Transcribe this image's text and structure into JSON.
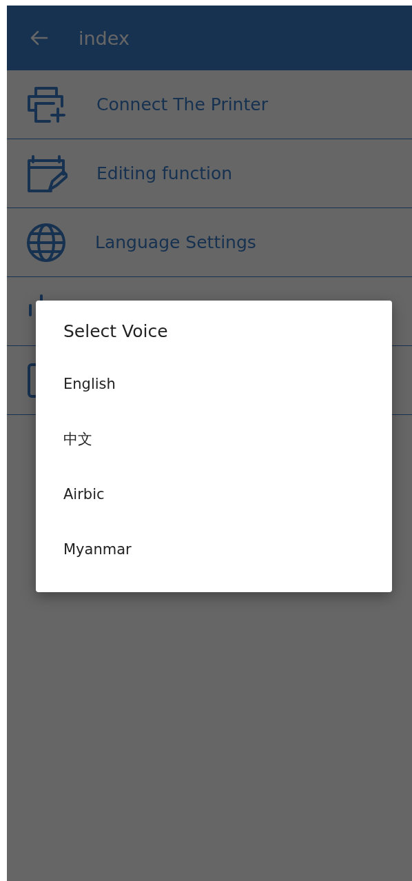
{
  "app_bar": {
    "title": "index"
  },
  "menu_items": [
    {
      "label": "Connect The Printer",
      "kind": "printer"
    },
    {
      "label": "Editing function",
      "kind": "calendar-edit"
    },
    {
      "label": "Language Settings",
      "kind": "globe"
    },
    {
      "kind": "bars"
    },
    {
      "kind": "frame"
    }
  ],
  "dialog": {
    "title": "Select Voice",
    "options": [
      "English",
      "中文",
      "Airbic",
      "Myanmar"
    ]
  }
}
